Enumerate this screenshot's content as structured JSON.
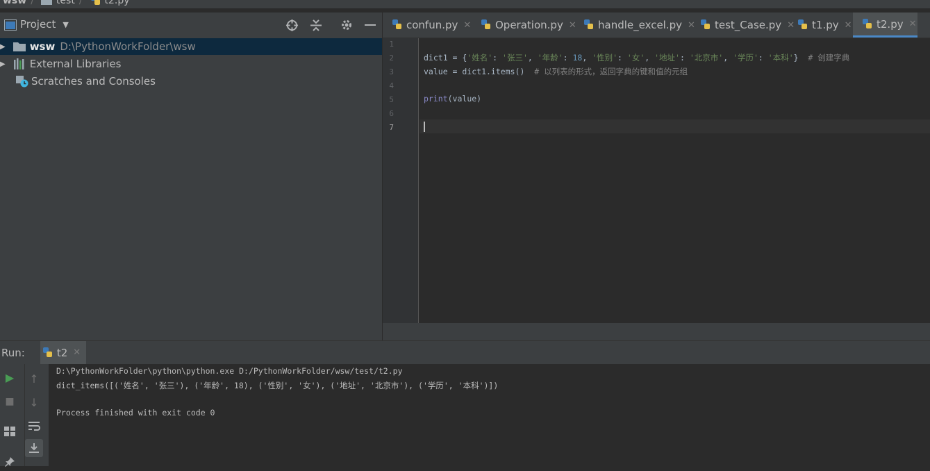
{
  "breadcrumb": [
    "wsw",
    "test",
    "t2.py"
  ],
  "project": {
    "title": "Project",
    "tree": [
      {
        "name": "wsw",
        "path": "D:\\PythonWorkFolder\\wsw"
      },
      {
        "name": "External Libraries"
      },
      {
        "name": "Scratches and Consoles"
      }
    ]
  },
  "tabs": [
    {
      "label": "confun.py"
    },
    {
      "label": "Operation.py"
    },
    {
      "label": "handle_excel.py"
    },
    {
      "label": "test_Case.py"
    },
    {
      "label": "t1.py"
    },
    {
      "label": "t2.py",
      "active": true
    }
  ],
  "editor": {
    "line_numbers": [
      "1",
      "2",
      "3",
      "4",
      "5",
      "6",
      "7"
    ],
    "line2": {
      "a": "dict1 = {",
      "k1": "'姓名'",
      "v1": "'张三'",
      "k2": "'年龄'",
      "v2": "18",
      "k3": "'性别'",
      "v3": "'女'",
      "k4": "'地址'",
      "v4": "'北京市'",
      "k5": "'学历'",
      "v5": "'本科'",
      "comment": "# 创建字典"
    },
    "line3": {
      "code": "value = dict1.items()",
      "comment": "# 以列表的形式，返回字典的键和值的元组"
    },
    "line5": {
      "fn": "print",
      "args": "(value)"
    }
  },
  "run": {
    "label": "Run:",
    "tab": "t2",
    "console": [
      "D:\\PythonWorkFolder\\python\\python.exe D:/PythonWorkFolder/wsw/test/t2.py",
      "dict_items([('姓名', '张三'), ('年龄', 18), ('性别', '女'), ('地址', '北京市'), ('学历', '本科')])",
      "",
      "Process finished with exit code 0"
    ]
  },
  "colors": {
    "accent": "#4a88c7",
    "string": "#6a8759",
    "number": "#6897bb",
    "comment": "#808080",
    "run_green": "#499c54"
  }
}
